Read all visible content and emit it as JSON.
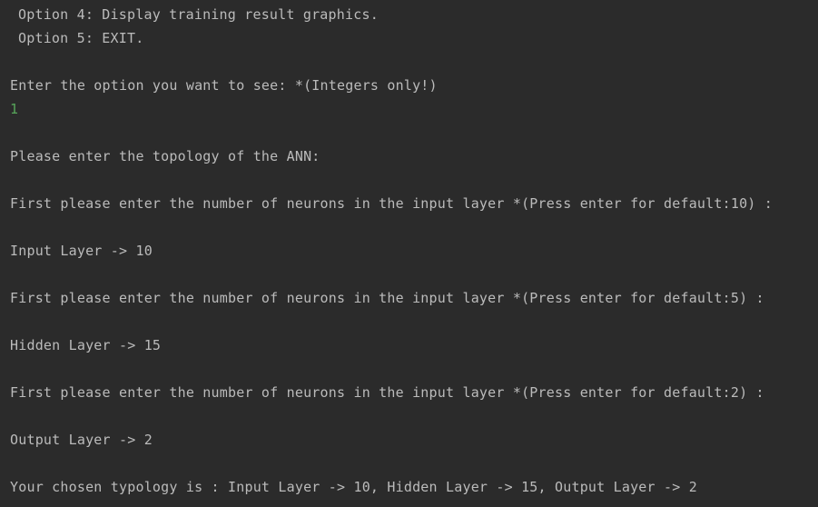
{
  "console": {
    "option_4": "Option 4: Display training result graphics.",
    "option_5": "Option 5: EXIT.",
    "option_prompt": "Enter the option you want to see: *(Integers only!)",
    "user_choice": "1",
    "topology_prompt": "Please enter the topology of the ANN:",
    "input_layer_prompt": "First please enter the number of neurons in the input layer *(Press enter for default:10) :",
    "input_layer_result": "Input Layer -> 10",
    "hidden_layer_prompt": "First please enter the number of neurons in the input layer *(Press enter for default:5) :",
    "hidden_layer_result": "Hidden Layer -> 15",
    "output_layer_prompt": "First please enter the number of neurons in the input layer *(Press enter for default:2) :",
    "output_layer_result": "Output Layer -> 2",
    "summary": "Your chosen typology is : Input Layer -> 10, Hidden Layer -> 15, Output Layer -> 2"
  },
  "colors": {
    "background": "#2b2b2b",
    "text": "#bbbbbb",
    "user_input": "#57a55a"
  }
}
